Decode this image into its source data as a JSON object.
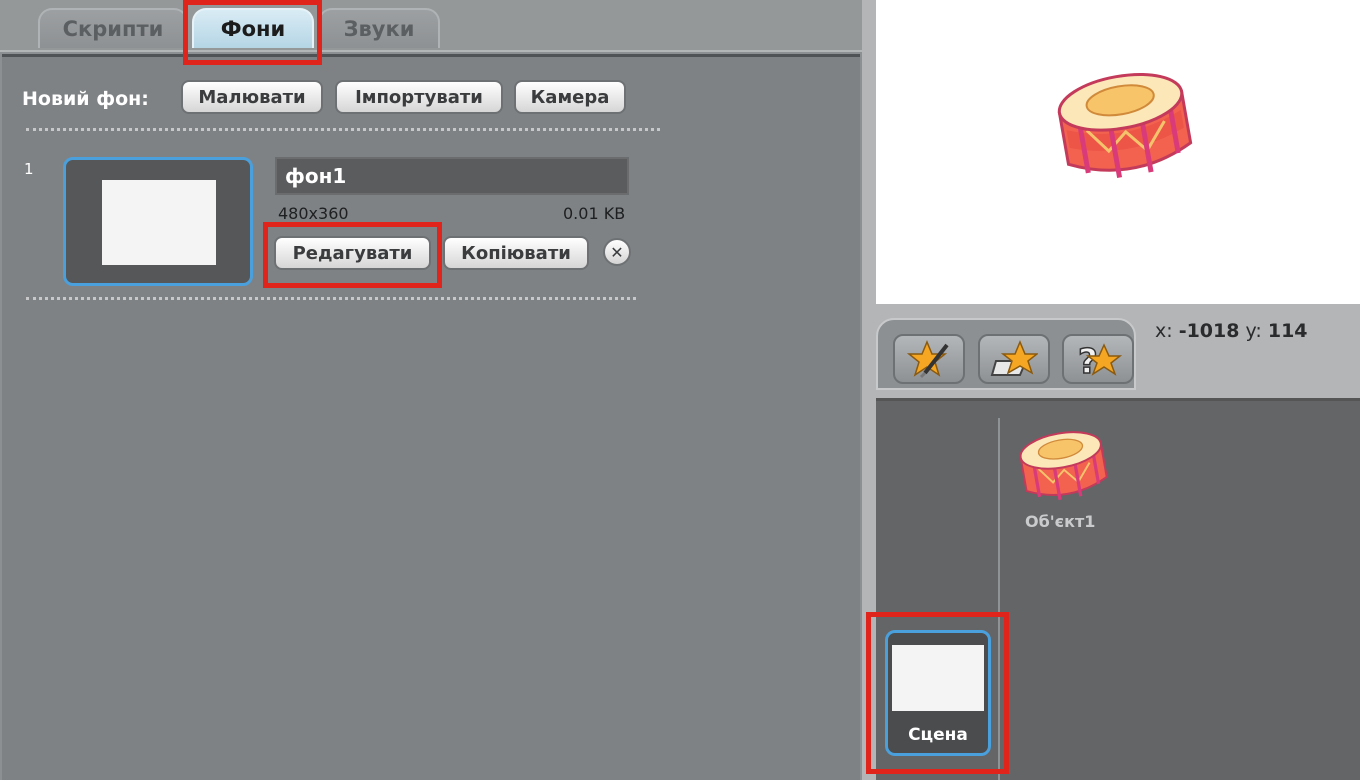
{
  "tabs": {
    "scripts": "Скрипти",
    "costumes": "Фони",
    "sounds": "Звуки"
  },
  "new_background": {
    "label": "Новий фон:",
    "paint": "Малювати",
    "import": "Імпортувати",
    "camera": "Камера"
  },
  "costume": {
    "number": "1",
    "name": "фон1",
    "size": "480x360",
    "file_size": "0.01 KB",
    "edit": "Редагувати",
    "copy": "Копіювати",
    "delete_symbol": "✕"
  },
  "coords": {
    "x_label": "x:",
    "x_value": "-1018",
    "y_label": "y:",
    "y_value": "114"
  },
  "sprites": [
    {
      "name": "Об'єкт1"
    }
  ],
  "stage": {
    "label": "Сцена"
  },
  "icons": {
    "paint_sprite": "paint-new-sprite-icon",
    "file_sprite": "choose-sprite-from-file-icon",
    "surprise_sprite": "surprise-sprite-icon",
    "delete": "close-icon"
  },
  "colors": {
    "highlight": "#e0231b",
    "selection_border": "#4aa0dc",
    "active_tab": "#c9e3ef"
  }
}
